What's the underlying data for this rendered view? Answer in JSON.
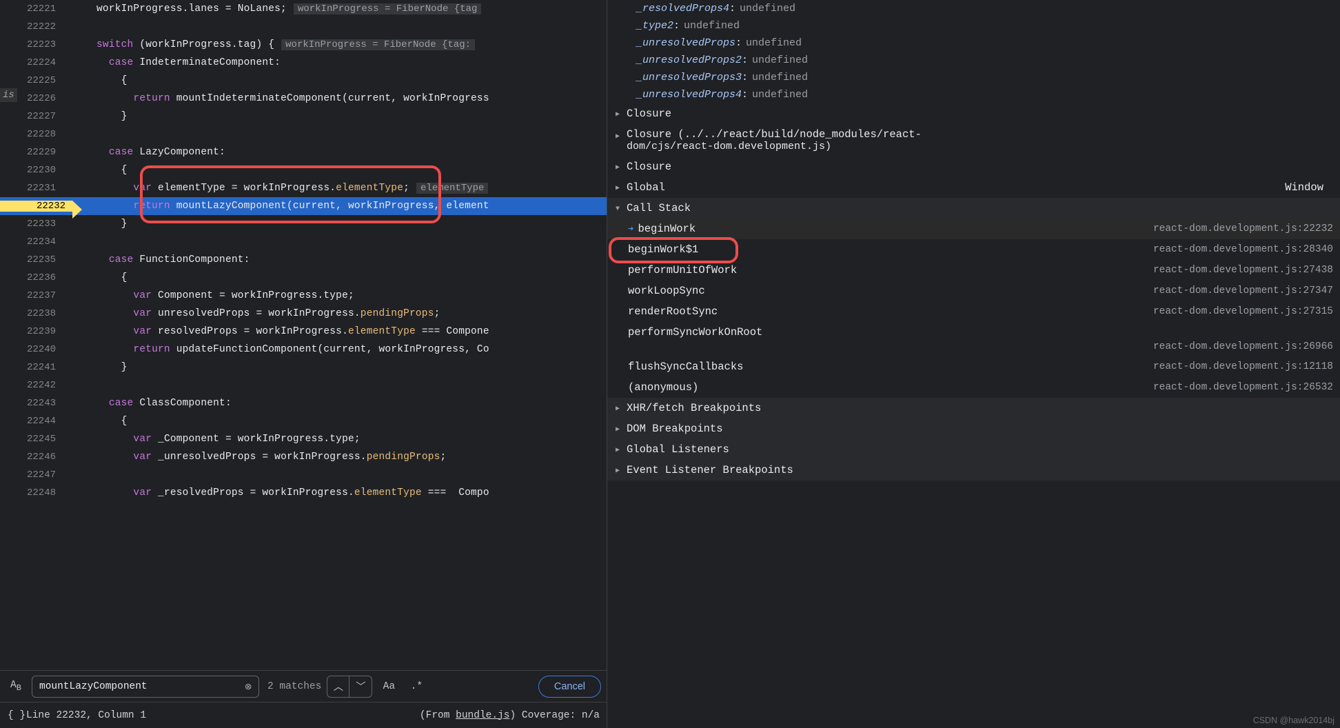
{
  "editor": {
    "tab_stub": "is",
    "lines": [
      {
        "no": 22221,
        "html": "workInProgress.lanes = NoLanes;",
        "faded": true,
        "hint": "workInProgress = FiberNode {tag"
      },
      {
        "no": 22222,
        "html": ""
      },
      {
        "no": 22223,
        "html": "<span class='kw'>switch</span> (workInProgress.tag) {",
        "hint": "workInProgress = FiberNode {tag:"
      },
      {
        "no": 22224,
        "html": "  <span class='kw'>case</span> IndeterminateComponent:"
      },
      {
        "no": 22225,
        "html": "    {"
      },
      {
        "no": 22226,
        "html": "      <span class='kw2'>return</span> mountIndeterminateComponent(current, workInProgress"
      },
      {
        "no": 22227,
        "html": "    }"
      },
      {
        "no": 22228,
        "html": ""
      },
      {
        "no": 22229,
        "html": "  <span class='kw'>case</span> LazyComponent:"
      },
      {
        "no": 22230,
        "html": "    {"
      },
      {
        "no": 22231,
        "html": "      <span class='kw'>var</span> elementType = workInProgress.<span class='prop'>elementType</span>;",
        "hint": "elementType"
      },
      {
        "no": 22232,
        "html": "      <span class='kw2'>return</span> mountLazyComponent(current, workInProgress, element",
        "highlight": true
      },
      {
        "no": 22233,
        "html": "    }"
      },
      {
        "no": 22234,
        "html": ""
      },
      {
        "no": 22235,
        "html": "  <span class='kw'>case</span> FunctionComponent:"
      },
      {
        "no": 22236,
        "html": "    {"
      },
      {
        "no": 22237,
        "html": "      <span class='kw'>var</span> Component = workInProgress.type;"
      },
      {
        "no": 22238,
        "html": "      <span class='kw'>var</span> unresolvedProps = workInProgress.<span class='prop'>pendingProps</span>;"
      },
      {
        "no": 22239,
        "html": "      <span class='kw'>var</span> resolvedProps = workInProgress.<span class='prop'>elementType</span> === Compone"
      },
      {
        "no": 22240,
        "html": "      <span class='kw2'>return</span> updateFunctionComponent(current, workInProgress, Co"
      },
      {
        "no": 22241,
        "html": "    }"
      },
      {
        "no": 22242,
        "html": ""
      },
      {
        "no": 22243,
        "html": "  <span class='kw'>case</span> ClassComponent:"
      },
      {
        "no": 22244,
        "html": "    {"
      },
      {
        "no": 22245,
        "html": "      <span class='kw'>var</span> _Component = workInProgress.type;"
      },
      {
        "no": 22246,
        "html": "      <span class='kw'>var</span> _unresolvedProps = workInProgress.<span class='prop'>pendingProps</span>;"
      },
      {
        "no": 22247,
        "html": ""
      },
      {
        "no": 22248,
        "html": "      <span class='kw'>var</span> _resolvedProps = workInProgress.<span class='prop'>elementType</span> ===  Compo"
      }
    ],
    "find": {
      "icon_label": "A͙ᵦ",
      "value": "mountLazyComponent",
      "matches": "2 matches",
      "case_label": "Aa",
      "regex_label": ".*",
      "cancel": "Cancel"
    },
    "status": {
      "icon": "{ }",
      "pos": "Line 22232, Column 1",
      "coverage_prefix": "(From ",
      "coverage_file": "bundle.js",
      "coverage_suffix": ") Coverage: n/a"
    }
  },
  "debug": {
    "scope_vars": [
      {
        "name": "_resolvedProps4",
        "value": "undefined"
      },
      {
        "name": "_type2",
        "value": "undefined"
      },
      {
        "name": "_unresolvedProps",
        "value": "undefined"
      },
      {
        "name": "_unresolvedProps2",
        "value": "undefined"
      },
      {
        "name": "_unresolvedProps3",
        "value": "undefined"
      },
      {
        "name": "_unresolvedProps4",
        "value": "undefined"
      }
    ],
    "closures": {
      "c1": "Closure",
      "c2a": "Closure (../../react/build/node_modules/react-",
      "c2b": "dom/cjs/react-dom.development.js)",
      "c3": "Closure",
      "global": "Global",
      "global_extra": "Window"
    },
    "callstack_title": "Call Stack",
    "callstack": [
      {
        "fn": "beginWork",
        "loc": "react-dom.development.js:22232",
        "active": true
      },
      {
        "fn": "beginWork$1",
        "loc": "react-dom.development.js:28340"
      },
      {
        "fn": "performUnitOfWork",
        "loc": "react-dom.development.js:27438"
      },
      {
        "fn": "workLoopSync",
        "loc": "react-dom.development.js:27347"
      },
      {
        "fn": "renderRootSync",
        "loc": "react-dom.development.js:27315"
      },
      {
        "fn": "performSyncWorkOnRoot",
        "loc": "react-dom.development.js:26966",
        "wrap": true
      },
      {
        "fn": "flushSyncCallbacks",
        "loc": "react-dom.development.js:12118"
      },
      {
        "fn": "(anonymous)",
        "loc": "react-dom.development.js:26532"
      }
    ],
    "sections": [
      "XHR/fetch Breakpoints",
      "DOM Breakpoints",
      "Global Listeners",
      "Event Listener Breakpoints"
    ],
    "watermark": "CSDN @hawk2014bj"
  }
}
